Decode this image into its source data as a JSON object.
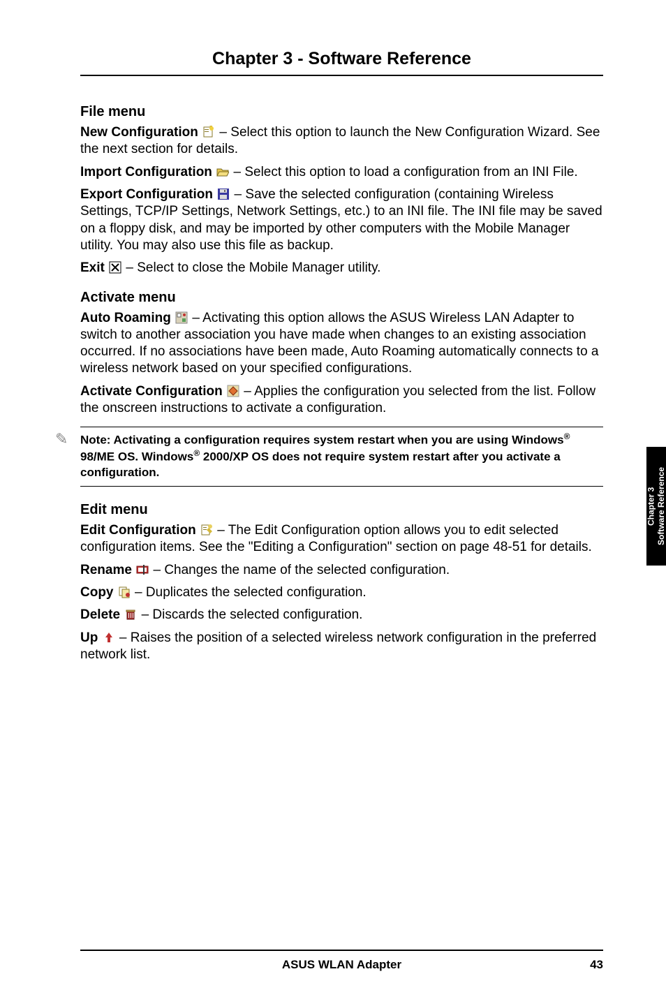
{
  "chapter_title": "Chapter 3 - Software Reference",
  "side_tab": {
    "line1": "Chapter 3",
    "line2": "Software Reference"
  },
  "file_menu": {
    "heading": "File menu",
    "new_cfg_label": "New Configuration ",
    "new_cfg_text": " – Select this option to launch the New Configuration Wizard. See the next section for details.",
    "import_cfg_label": "Import Configuration ",
    "import_cfg_text": " – Select this option to load a configuration from an INI File.",
    "export_cfg_label": "Export Configuration ",
    "export_cfg_text": " – Save the selected configuration (containing Wireless Settings, TCP/IP Settings, Network Settings, etc.) to an INI file. The INI file may be saved on a floppy disk, and may be imported by other computers with the Mobile Manager utility. You may also use this file as backup.",
    "exit_label": "Exit ",
    "exit_text": " – Select to close the Mobile Manager utility."
  },
  "activate_menu": {
    "heading": "Activate menu",
    "auto_roaming_label": "Auto Roaming ",
    "auto_roaming_text": " – Activating this option allows the ASUS Wireless LAN Adapter to switch to another association you have made when changes to an existing association occurred. If no associations have been made, Auto Roaming automatically connects to a wireless network based on your specified configurations.",
    "activate_cfg_label": "Activate Configuration ",
    "activate_cfg_text": " – Applies the configuration you selected from the list. Follow the onscreen instructions to activate a configuration."
  },
  "note": {
    "part1": "Note: Activating a configuration requires system restart when you are using Windows",
    "reg1": "®",
    "part2": " 98/ME OS. Windows",
    "reg2": "®",
    "part3": " 2000/XP OS does not require system restart after you activate a configuration."
  },
  "edit_menu": {
    "heading": "Edit menu",
    "edit_cfg_label": "Edit Configuration ",
    "edit_cfg_text": " – The Edit Configuration option allows you to edit selected configuration items. See the \"Editing a Configuration\" section on page 48-51 for details.",
    "rename_label": "Rename ",
    "rename_text": " – Changes the name of the selected configuration.",
    "copy_label": "Copy ",
    "copy_text": " – Duplicates the selected configuration.",
    "delete_label": "Delete ",
    "delete_text": " – Discards the selected configuration.",
    "up_label": "Up ",
    "up_text": "  – Raises the position of a selected wireless network configuration in the preferred network list."
  },
  "footer": {
    "center": "ASUS WLAN Adapter",
    "page": "43"
  }
}
